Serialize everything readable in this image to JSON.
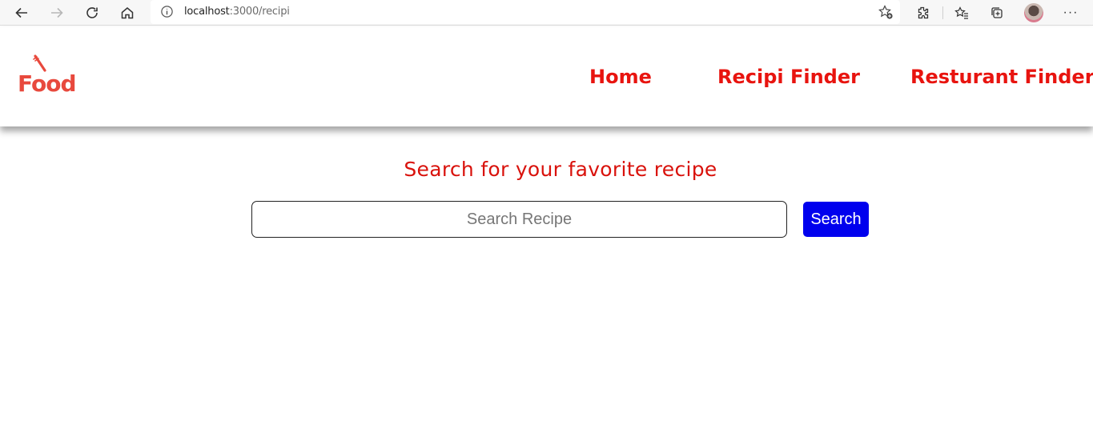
{
  "browser": {
    "url_host": "localhost",
    "url_path": ":3000/recipi"
  },
  "site": {
    "logo_text": "Food",
    "nav": [
      {
        "label": "Home"
      },
      {
        "label": "Recipi Finder"
      },
      {
        "label": "Resturant Finder"
      }
    ]
  },
  "main": {
    "heading": "Search for your favorite recipe",
    "search_placeholder": "Search Recipe",
    "search_button_label": "Search"
  },
  "colors": {
    "brand_red": "#e8140f",
    "button_blue": "#0000ee"
  }
}
